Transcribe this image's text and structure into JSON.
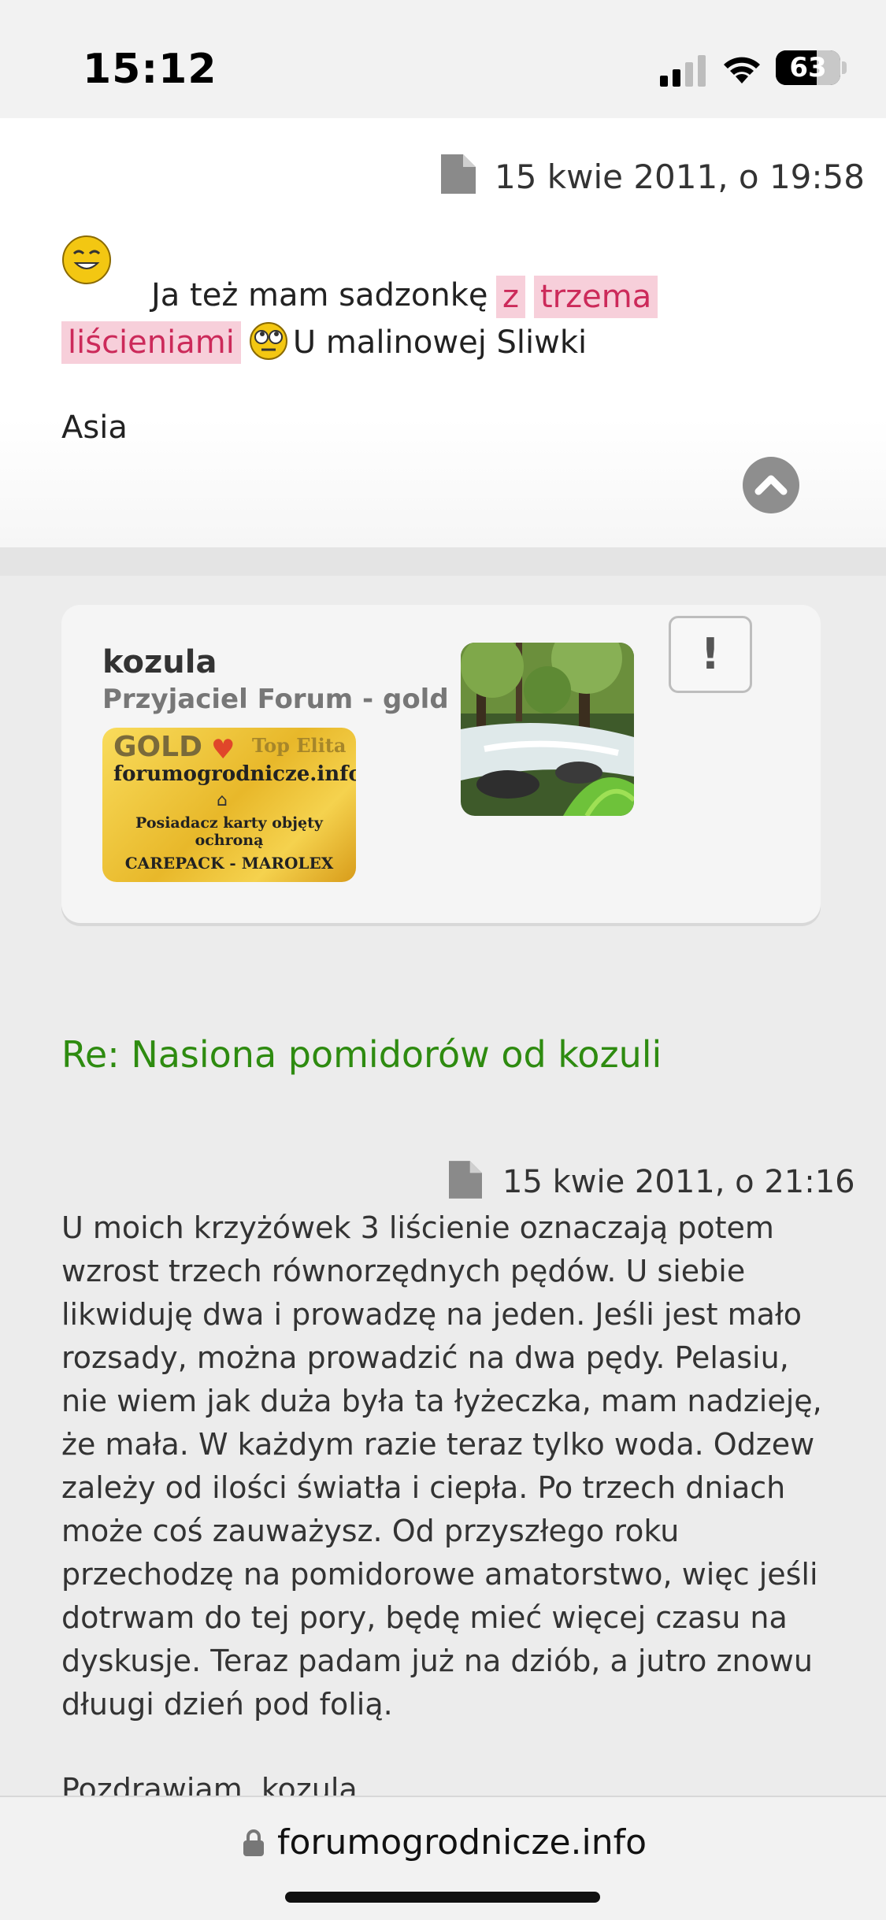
{
  "status_bar": {
    "time": "15:12",
    "battery_percent": "63",
    "battery_level": 0.63,
    "icons": [
      "signal-icon",
      "wifi-icon",
      "battery-icon"
    ]
  },
  "post1": {
    "date": "15 kwie 2011, o 19:58",
    "text_start": "Ja też mam sadzonkę",
    "highlight_1": "z",
    "highlight_2": "trzema",
    "highlight_3": "liścieniami",
    "text_end": "U malinowej Sliwki",
    "signature": "Asia",
    "icons": [
      "document-icon",
      "smiley-icon",
      "rolling-eyes-icon",
      "scroll-up-icon"
    ]
  },
  "profile": {
    "username": "kozula",
    "rank": "Przyjaciel Forum - gold",
    "badge": {
      "gold": "GOLD",
      "top": "Top Elita",
      "site": "forumogrodnicze.info",
      "line1": "Posiadacz karty objęty",
      "line2": "ochroną",
      "line3": "CAREPACK - MAROLEX"
    },
    "report_symbol": "!"
  },
  "post2": {
    "title": "Re: Nasiona pomidorów od kozuli",
    "date": "15 kwie 2011, o 21:16",
    "body": "U moich krzyżówek 3 liścienie oznaczają potem wzrost trzech równorzędnych pędów. U siebie likwiduję dwa i prowadzę na jeden. Jeśli jest mało rozsady, można prowadzić na dwa pędy. Pelasiu, nie wiem jak duża była ta łyżeczka, mam nadzieję, że mała. W każdym razie teraz tylko woda. Odzew zależy od ilości światła i ciepła. Po trzech dniach może coś zauważysz. Od przyszłego roku przechodzę na pomidorowe amatorstwo, więc jeśli dotrwam do tej pory, będę mieć więcej czasu na dyskusje. Teraz padam już na dziób, a jutro znowu dłuugi dzień pod folią.",
    "greeting": "Pozdrawiam, kozula"
  },
  "browser": {
    "url": "forumogrodnicze.info",
    "icons": [
      "lock-icon"
    ]
  },
  "colors": {
    "title_green": "#2e8b10",
    "highlight_bg": "#f7cfda",
    "highlight_text": "#cc2a5a"
  }
}
